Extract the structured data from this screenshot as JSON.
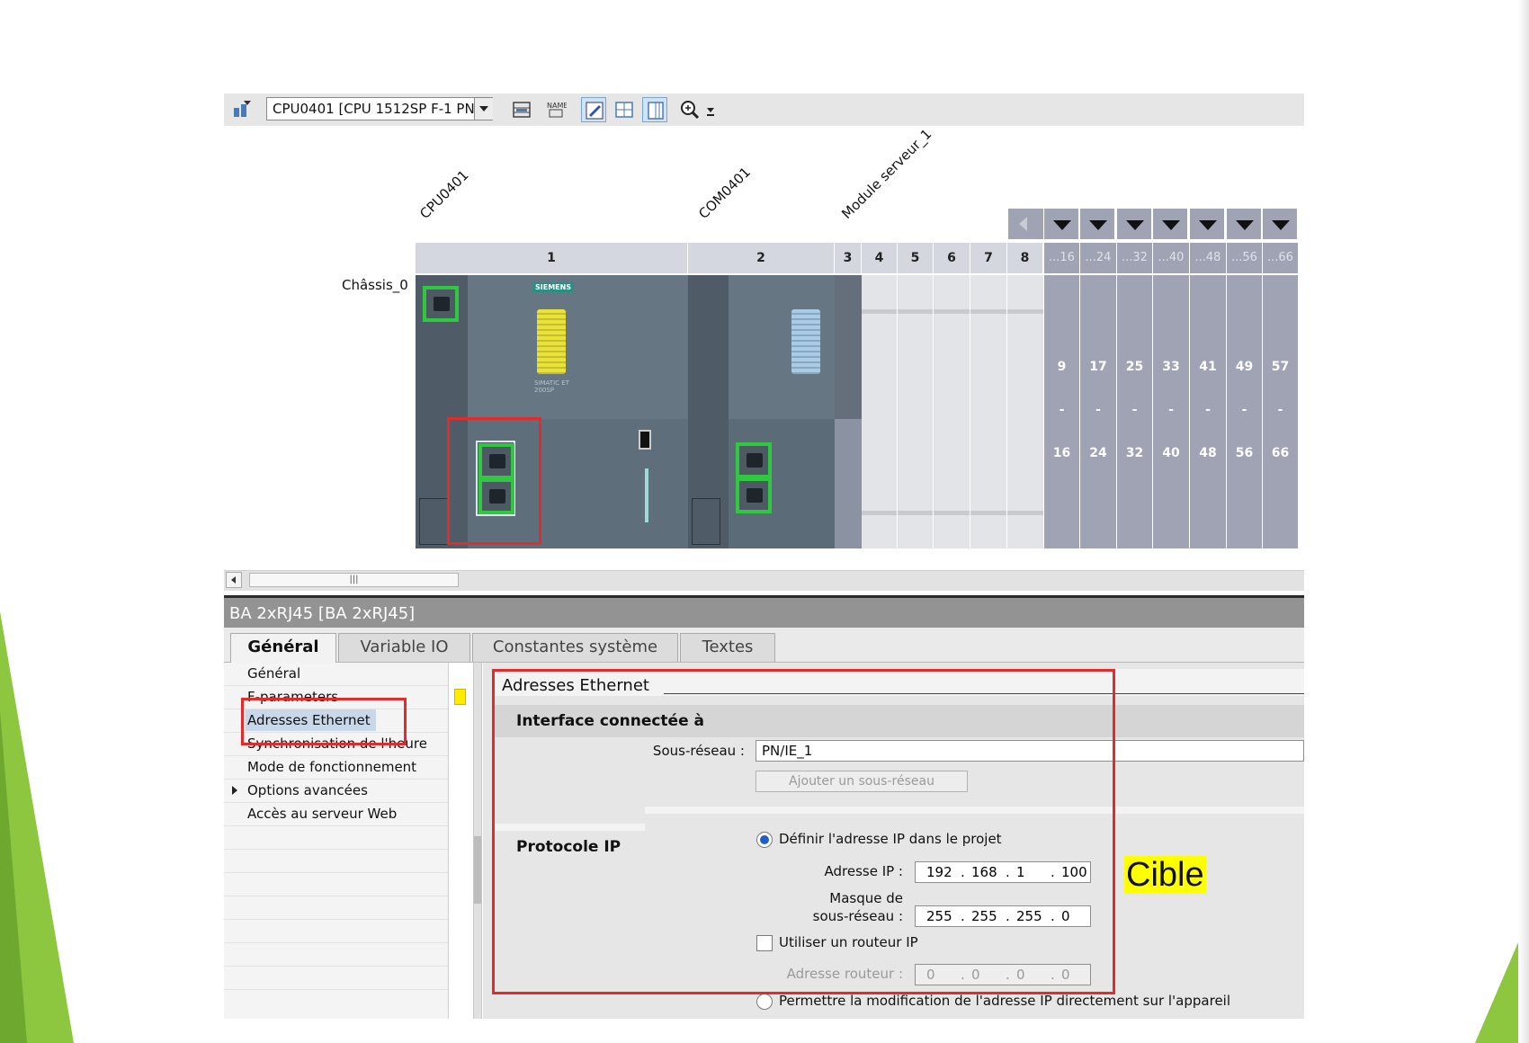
{
  "toolbar": {
    "device_selector_value": "CPU0401 [CPU 1512SP F-1 PN]",
    "icons": [
      "network-topology-icon",
      "device-list-icon",
      "name-label-icon",
      "show-modules-icon",
      "grid-view-icon",
      "columns-view-icon",
      "zoom-icon",
      "zoom-dropdown-icon"
    ]
  },
  "device_view": {
    "modules": [
      "CPU0401",
      "COM0401",
      "Module serveur_1"
    ],
    "chassis_label": "Châssis_0",
    "slots": [
      "1",
      "2",
      "3",
      "4",
      "5",
      "6",
      "7",
      "8"
    ],
    "group_headers": [
      "...16",
      "...24",
      "...32",
      "...40",
      "...48",
      "...56",
      "...66"
    ],
    "group_ranges": [
      {
        "start": "9",
        "sep": "-",
        "end": "16"
      },
      {
        "start": "17",
        "sep": "-",
        "end": "24"
      },
      {
        "start": "25",
        "sep": "-",
        "end": "32"
      },
      {
        "start": "33",
        "sep": "-",
        "end": "40"
      },
      {
        "start": "41",
        "sep": "-",
        "end": "48"
      },
      {
        "start": "49",
        "sep": "-",
        "end": "56"
      },
      {
        "start": "57",
        "sep": "-",
        "end": "66"
      }
    ],
    "cpu_brand": "SIEMENS",
    "cpu_model_text": "SIMATIC ET 200SP"
  },
  "properties": {
    "header": "BA 2xRJ45 [BA 2xRJ45]",
    "tabs": [
      "Général",
      "Variable IO",
      "Constantes système",
      "Textes"
    ],
    "nav": [
      "Général",
      "F-parameters",
      "Adresses Ethernet",
      "Synchronisation de l'heure",
      "Mode de fonctionnement",
      "Options avancées",
      "Accès au serveur Web"
    ],
    "section_title": "Adresses Ethernet",
    "interface": {
      "title": "Interface connectée à",
      "subnet_label": "Sous-réseau :",
      "subnet_value": "PN/IE_1",
      "add_subnet_button": "Ajouter un sous-réseau"
    },
    "ip_protocol": {
      "title": "Protocole IP",
      "define_ip_option": "Définir l'adresse IP dans le projet",
      "ip_label": "Adresse IP :",
      "ip": [
        "192",
        "168",
        "1",
        "100"
      ],
      "mask_label_line1": "Masque de",
      "mask_label_line2": "sous-réseau :",
      "mask": [
        "255",
        "255",
        "255",
        "0"
      ],
      "router_checkbox": "Utiliser un routeur IP",
      "router_label": "Adresse routeur :",
      "router": [
        "0",
        "0",
        "0",
        "0"
      ],
      "modify_on_device_option": "Permettre la modification de l'adresse IP directement sur l'appareil"
    }
  },
  "annotation": {
    "cible": "Cible"
  },
  "colors": {
    "accent_green": "#8dc63f",
    "highlight_red": "#e22b2b",
    "highlight_yellow": "#ffff00",
    "port_green": "#2fc840"
  }
}
